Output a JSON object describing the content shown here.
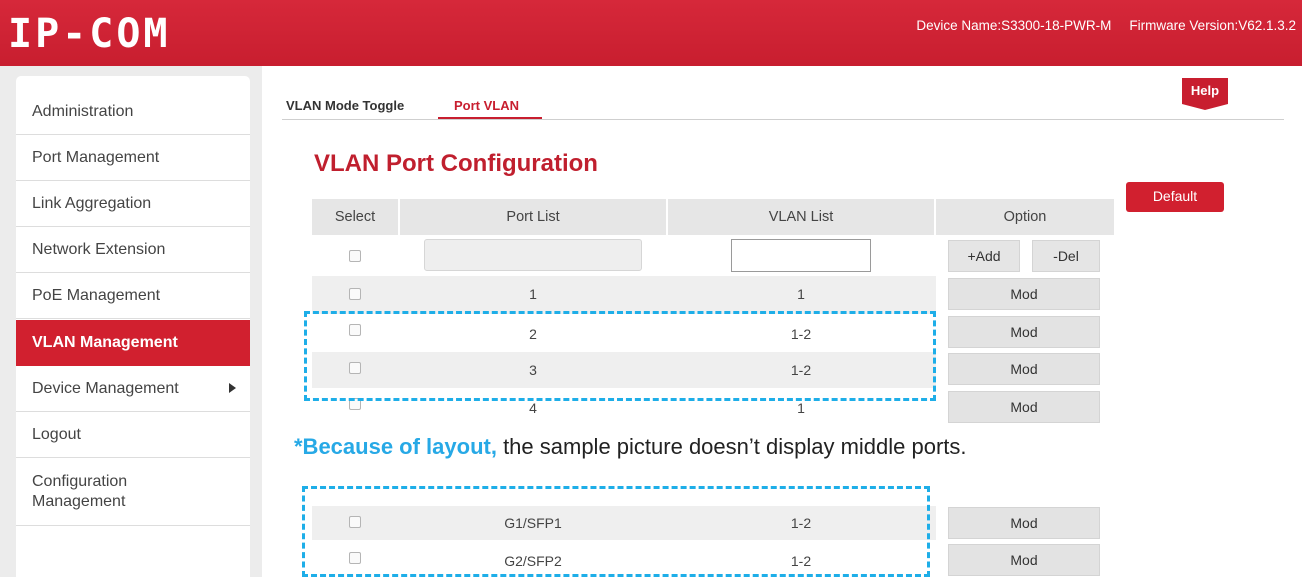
{
  "header": {
    "logo_text": "IP-COM",
    "device_name": "Device Name:S3300-18-PWR-M",
    "firmware_version": "Firmware Version:V62.1.3.2"
  },
  "sidebar": {
    "items": [
      {
        "label": "Administration"
      },
      {
        "label": "Port Management"
      },
      {
        "label": "Link Aggregation"
      },
      {
        "label": "Network Extension"
      },
      {
        "label": "PoE Management"
      },
      {
        "label": "VLAN Management",
        "active": true
      },
      {
        "label": "Device Management",
        "has_submenu": true
      },
      {
        "label": "Logout"
      },
      {
        "label_line1": "Configuration",
        "label_line2": "Management"
      }
    ]
  },
  "tabs": [
    {
      "label": "VLAN Mode Toggle"
    },
    {
      "label": "Port VLAN",
      "active": true
    }
  ],
  "help_label": "Help",
  "page_title": "VLAN Port Configuration",
  "default_label": "Default",
  "table": {
    "headers": [
      "Select",
      "Port List",
      "VLAN List",
      "Option"
    ],
    "add_label": "+Add",
    "del_label": "-Del",
    "mod_label": "Mod",
    "rows_top": [
      {
        "port": "1",
        "vlan": "1"
      },
      {
        "port": "2",
        "vlan": "1-2"
      },
      {
        "port": "3",
        "vlan": "1-2"
      },
      {
        "port": "4",
        "vlan": "1"
      }
    ],
    "rows_bottom": [
      {
        "port": "G1/SFP1",
        "vlan": "1-2"
      },
      {
        "port": "G2/SFP2",
        "vlan": "1-2"
      }
    ]
  },
  "note": {
    "emphasis": "*Because of layout,",
    "text": " the sample picture doesn’t display middle ports."
  },
  "colors": {
    "brand_red": "#d1202f",
    "highlight_blue": "#1eaee8"
  }
}
